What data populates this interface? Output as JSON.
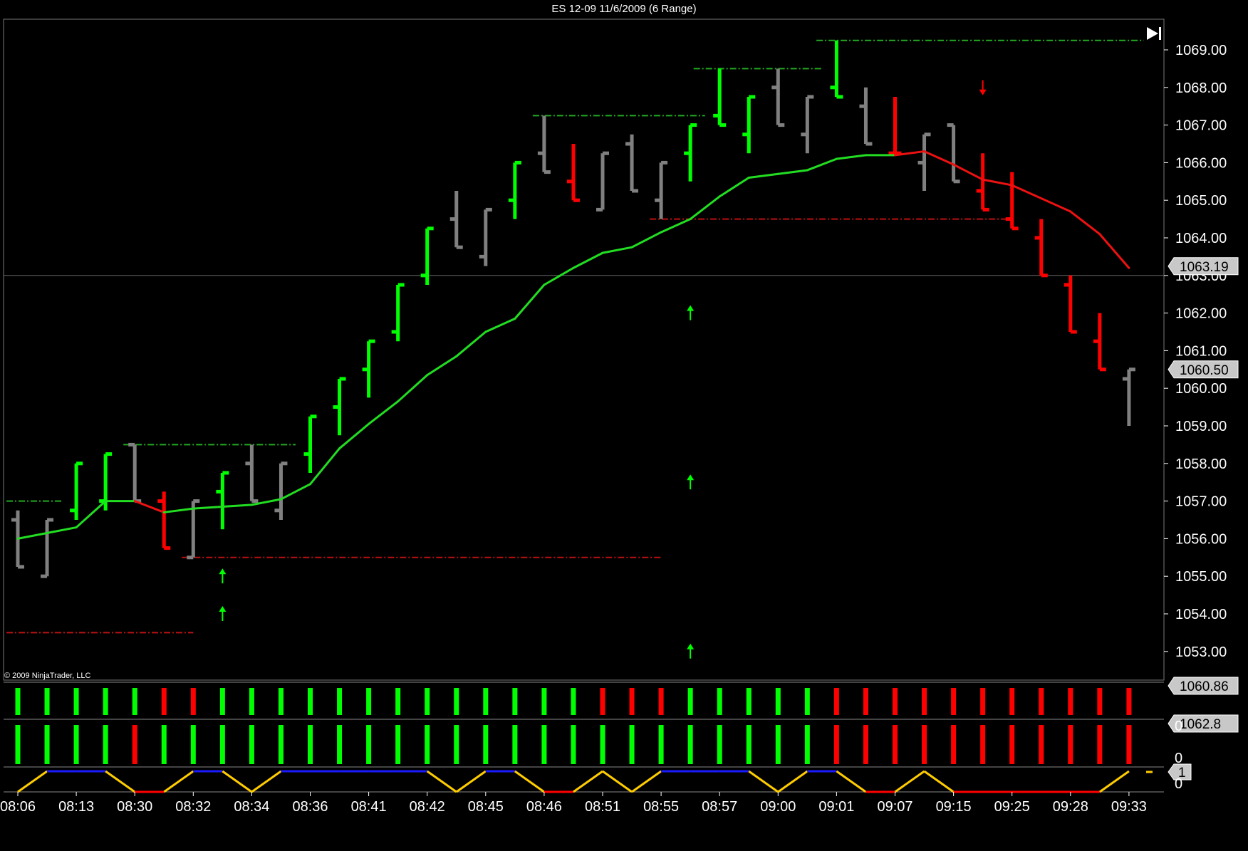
{
  "window": {
    "title": "ES 12-09  11/6/2009 (6 Range)"
  },
  "copyright": "© 2009 NinjaTrader, LLC",
  "colors": {
    "up": "#00ff00",
    "down": "#ff0000",
    "neutral": "#808080",
    "ema": "#22dd22",
    "ema_down": "#ee1111",
    "up_level": "#22aa22",
    "down_level": "#bb1111",
    "osc_yellow": "#ffcc00",
    "osc_blue": "#1a1aff",
    "osc_red": "#ff0000"
  },
  "icons": {
    "scroll_end": "skip-to-end-icon"
  },
  "chart_data": {
    "type": "ohlc",
    "ylim": [
      1052.1,
      1069.9
    ],
    "y_ticks": [
      "1053.00",
      "1054.00",
      "1055.00",
      "1056.00",
      "1057.00",
      "1058.00",
      "1059.00",
      "1060.00",
      "1061.00",
      "1062.00",
      "1063.00",
      "1064.00",
      "1065.00",
      "1066.00",
      "1067.00",
      "1068.00",
      "1069.00"
    ],
    "x_tick_labels": [
      "08:06",
      "08:13",
      "08:30",
      "08:32",
      "08:34",
      "08:36",
      "08:41",
      "08:42",
      "08:45",
      "08:46",
      "08:51",
      "08:55",
      "08:57",
      "09:00",
      "09:01",
      "09:07",
      "09:15",
      "09:25",
      "09:28",
      "09:33"
    ],
    "x_tick_bars": [
      0,
      2,
      4,
      6,
      8,
      10,
      12,
      14,
      16,
      18,
      20,
      22,
      24,
      26,
      28,
      30,
      32,
      34,
      36,
      38
    ],
    "last_price_tag": "1060.50",
    "crosshair_tag": "1063.19",
    "crosshair_value": 1063.0,
    "bars": [
      {
        "o": 1056.5,
        "h": 1056.75,
        "l": 1055.25,
        "c": 1055.25,
        "col": "neutral"
      },
      {
        "o": 1055.0,
        "h": 1056.5,
        "l": 1055.0,
        "c": 1056.5,
        "col": "neutral"
      },
      {
        "o": 1056.75,
        "h": 1058.0,
        "l": 1056.5,
        "c": 1058.0,
        "col": "up"
      },
      {
        "o": 1057.0,
        "h": 1058.25,
        "l": 1056.75,
        "c": 1058.25,
        "col": "up"
      },
      {
        "o": 1058.5,
        "h": 1058.5,
        "l": 1057.0,
        "c": 1057.0,
        "col": "neutral"
      },
      {
        "o": 1057.0,
        "h": 1057.25,
        "l": 1055.75,
        "c": 1055.75,
        "col": "down"
      },
      {
        "o": 1055.5,
        "h": 1057.0,
        "l": 1055.5,
        "c": 1057.0,
        "col": "neutral"
      },
      {
        "o": 1057.25,
        "h": 1057.75,
        "l": 1056.25,
        "c": 1057.75,
        "col": "up"
      },
      {
        "o": 1058.0,
        "h": 1058.5,
        "l": 1057.0,
        "c": 1057.0,
        "col": "neutral"
      },
      {
        "o": 1056.75,
        "h": 1058.0,
        "l": 1056.5,
        "c": 1058.0,
        "col": "neutral"
      },
      {
        "o": 1058.25,
        "h": 1059.25,
        "l": 1057.75,
        "c": 1059.25,
        "col": "up"
      },
      {
        "o": 1059.5,
        "h": 1060.25,
        "l": 1058.75,
        "c": 1060.25,
        "col": "up"
      },
      {
        "o": 1060.5,
        "h": 1061.25,
        "l": 1059.75,
        "c": 1061.25,
        "col": "up"
      },
      {
        "o": 1061.5,
        "h": 1062.75,
        "l": 1061.25,
        "c": 1062.75,
        "col": "up"
      },
      {
        "o": 1063.0,
        "h": 1064.25,
        "l": 1062.75,
        "c": 1064.25,
        "col": "up"
      },
      {
        "o": 1064.5,
        "h": 1065.25,
        "l": 1063.75,
        "c": 1063.75,
        "col": "neutral"
      },
      {
        "o": 1063.5,
        "h": 1064.75,
        "l": 1063.25,
        "c": 1064.75,
        "col": "neutral"
      },
      {
        "o": 1065.0,
        "h": 1066.0,
        "l": 1064.5,
        "c": 1066.0,
        "col": "up"
      },
      {
        "o": 1066.25,
        "h": 1067.25,
        "l": 1065.75,
        "c": 1065.75,
        "col": "neutral"
      },
      {
        "o": 1065.5,
        "h": 1066.5,
        "l": 1065.0,
        "c": 1065.0,
        "col": "down"
      },
      {
        "o": 1064.75,
        "h": 1066.25,
        "l": 1064.75,
        "c": 1066.25,
        "col": "neutral"
      },
      {
        "o": 1066.5,
        "h": 1066.75,
        "l": 1065.25,
        "c": 1065.25,
        "col": "neutral"
      },
      {
        "o": 1065.0,
        "h": 1066.0,
        "l": 1064.5,
        "c": 1066.0,
        "col": "neutral"
      },
      {
        "o": 1066.25,
        "h": 1067.0,
        "l": 1065.5,
        "c": 1067.0,
        "col": "up"
      },
      {
        "o": 1067.25,
        "h": 1068.5,
        "l": 1067.0,
        "c": 1067.0,
        "col": "up"
      },
      {
        "o": 1066.75,
        "h": 1067.75,
        "l": 1066.25,
        "c": 1067.75,
        "col": "up"
      },
      {
        "o": 1068.0,
        "h": 1068.5,
        "l": 1067.0,
        "c": 1067.0,
        "col": "neutral"
      },
      {
        "o": 1066.75,
        "h": 1067.75,
        "l": 1066.25,
        "c": 1067.75,
        "col": "neutral"
      },
      {
        "o": 1068.0,
        "h": 1069.25,
        "l": 1067.75,
        "c": 1067.75,
        "col": "up"
      },
      {
        "o": 1067.5,
        "h": 1068.0,
        "l": 1066.5,
        "c": 1066.5,
        "col": "neutral"
      },
      {
        "o": 1066.25,
        "h": 1067.75,
        "l": 1066.25,
        "c": 1066.25,
        "col": "down"
      },
      {
        "o": 1066.0,
        "h": 1066.75,
        "l": 1065.25,
        "c": 1066.75,
        "col": "neutral"
      },
      {
        "o": 1067.0,
        "h": 1067.0,
        "l": 1065.5,
        "c": 1065.5,
        "col": "neutral"
      },
      {
        "o": 1065.25,
        "h": 1066.25,
        "l": 1064.75,
        "c": 1064.75,
        "col": "down"
      },
      {
        "o": 1064.5,
        "h": 1065.75,
        "l": 1064.25,
        "c": 1064.25,
        "col": "down"
      },
      {
        "o": 1064.0,
        "h": 1064.5,
        "l": 1063.0,
        "c": 1063.0,
        "col": "down"
      },
      {
        "o": 1062.75,
        "h": 1063.0,
        "l": 1061.5,
        "c": 1061.5,
        "col": "down"
      },
      {
        "o": 1061.25,
        "h": 1062.0,
        "l": 1060.5,
        "c": 1060.5,
        "col": "down"
      },
      {
        "o": 1060.25,
        "h": 1060.5,
        "l": 1059.0,
        "c": 1060.5,
        "col": "neutral"
      }
    ],
    "ema": [
      1056.0,
      1056.15,
      1056.3,
      1057.0,
      1057.0,
      1056.7,
      1056.8,
      1056.85,
      1056.9,
      1057.05,
      1057.45,
      1058.4,
      1059.05,
      1059.65,
      1060.35,
      1060.85,
      1061.5,
      1061.85,
      1062.75,
      1063.2,
      1063.6,
      1063.75,
      1064.15,
      1064.5,
      1065.1,
      1065.6,
      1065.7,
      1065.8,
      1066.1,
      1066.2,
      1066.2,
      1066.3,
      1065.95,
      1065.55,
      1065.4,
      1065.05,
      1064.7,
      1064.1,
      1063.2
    ],
    "ema_down_segments": [
      [
        4,
        5
      ],
      [
        30,
        38
      ]
    ],
    "levels": [
      {
        "value": 1057.0,
        "from": 0,
        "to": 1.5,
        "kind": "up_level"
      },
      {
        "value": 1058.5,
        "from": 4,
        "to": 9.5,
        "kind": "up_level"
      },
      {
        "value": 1067.25,
        "from": 18,
        "to": 23.5,
        "kind": "up_level"
      },
      {
        "value": 1068.5,
        "from": 23.5,
        "to": 27.5,
        "kind": "up_level"
      },
      {
        "value": 1069.25,
        "from": 27.7,
        "to": 38.5,
        "kind": "up_level"
      },
      {
        "value": 1053.5,
        "from": 0,
        "to": 6,
        "kind": "down_level"
      },
      {
        "value": 1055.5,
        "from": 6,
        "to": 22,
        "kind": "down_level"
      },
      {
        "value": 1064.5,
        "from": 22,
        "to": 34,
        "kind": "down_level"
      }
    ],
    "arrows": [
      {
        "bar": 7,
        "value": 1055.0,
        "dir": "up"
      },
      {
        "bar": 7,
        "value": 1054.0,
        "dir": "up"
      },
      {
        "bar": 23,
        "value": 1062.0,
        "dir": "up"
      },
      {
        "bar": 23,
        "value": 1057.5,
        "dir": "up"
      },
      {
        "bar": 23,
        "value": 1053.0,
        "dir": "up"
      },
      {
        "bar": 33,
        "value": 1068.0,
        "dir": "down"
      }
    ],
    "panel1": {
      "tag": "1060.86",
      "colors": [
        "up",
        "up",
        "up",
        "up",
        "up",
        "down",
        "down",
        "up",
        "up",
        "up",
        "up",
        "up",
        "up",
        "up",
        "up",
        "up",
        "up",
        "up",
        "up",
        "up",
        "down",
        "down",
        "down",
        "up",
        "up",
        "up",
        "up",
        "up",
        "down",
        "down",
        "down",
        "down",
        "down",
        "down",
        "down",
        "down",
        "down",
        "down",
        "down"
      ]
    },
    "panel2": {
      "tag": "1062.8",
      "colors": [
        "up",
        "up",
        "up",
        "up",
        "down",
        "up",
        "up",
        "up",
        "up",
        "up",
        "up",
        "up",
        "up",
        "up",
        "up",
        "up",
        "up",
        "up",
        "up",
        "up",
        "up",
        "up",
        "up",
        "up",
        "up",
        "up",
        "up",
        "up",
        "down",
        "down",
        "down",
        "down",
        "down",
        "down",
        "down",
        "down",
        "down",
        "down",
        "down"
      ]
    },
    "panel3": {
      "tag": "1",
      "zero_label": "0",
      "values": [
        0,
        1,
        1,
        1,
        0,
        0,
        1,
        1,
        0,
        1,
        1,
        1,
        1,
        1,
        1,
        0,
        1,
        1,
        0,
        0,
        1,
        0,
        1,
        1,
        1,
        1,
        0,
        1,
        1,
        0,
        0,
        1,
        0,
        0,
        0,
        0,
        0,
        0,
        1
      ],
      "segment_colors": [
        "osc_yellow",
        "osc_blue",
        "osc_blue",
        "osc_yellow",
        "osc_red",
        "osc_yellow",
        "osc_blue",
        "osc_yellow",
        "osc_yellow",
        "osc_blue",
        "osc_blue",
        "osc_blue",
        "osc_blue",
        "osc_blue",
        "osc_yellow",
        "osc_yellow",
        "osc_blue",
        "osc_yellow",
        "osc_red",
        "osc_yellow",
        "osc_yellow",
        "osc_yellow",
        "osc_blue",
        "osc_blue",
        "osc_blue",
        "osc_yellow",
        "osc_yellow",
        "osc_blue",
        "osc_yellow",
        "osc_red",
        "osc_yellow",
        "osc_yellow",
        "osc_red",
        "osc_red",
        "osc_red",
        "osc_red",
        "osc_red",
        "osc_yellow"
      ]
    }
  }
}
